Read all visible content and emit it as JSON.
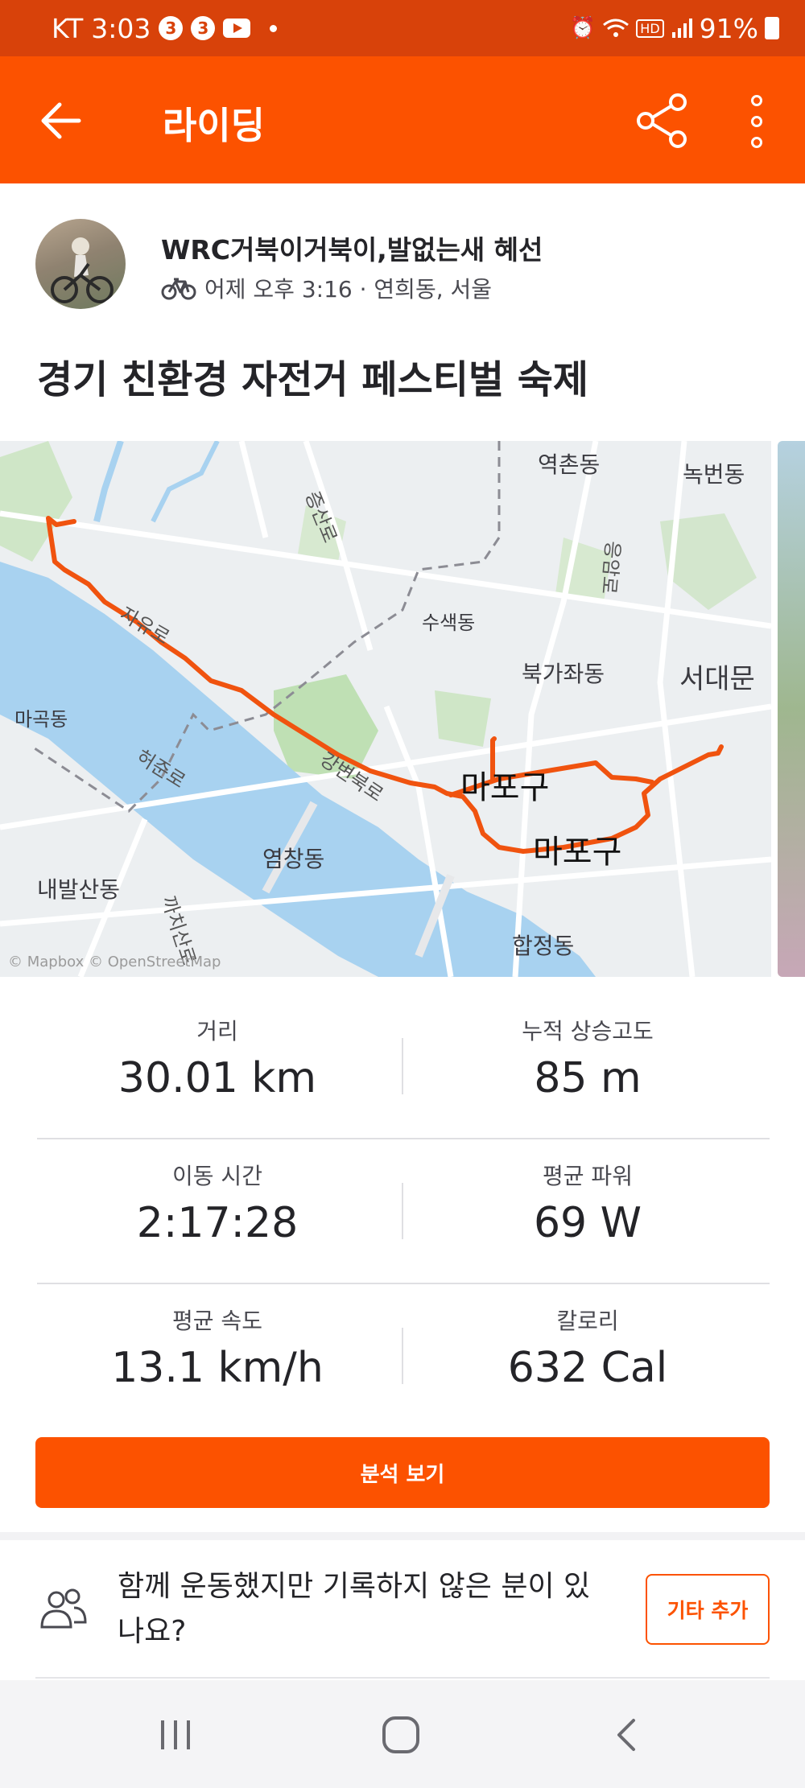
{
  "status_bar": {
    "carrier": "KT",
    "time": "3:03",
    "badge1": "3",
    "badge2": "3",
    "battery": "91%",
    "hd_label": "HD"
  },
  "app_bar": {
    "title": "라이딩"
  },
  "athlete": {
    "name": "WRC거북이거북이,발없는새 혜선",
    "meta": "어제 오후 3:16 · 연희동, 서울"
  },
  "activity": {
    "title": "경기 친환경 자전거 페스티벌 숙제"
  },
  "map": {
    "labels": {
      "yeokchon": "역촌동",
      "nokbeon": "녹번동",
      "susaek": "수색동",
      "bukgajwa": "북가좌동",
      "seodaemun": "서대문",
      "magok": "마곡동",
      "mapo1": "마포구",
      "mapo2": "마포구",
      "yeomchang": "염창동",
      "naebalsan": "내발산동",
      "hapjeong": "합정동",
      "gangbyeon": "강변북로",
      "heojun": "허준로",
      "jayu": "자유로",
      "jeungsan": "증산로",
      "kkachisan": "까치산로",
      "eungam": "응암로"
    },
    "attribution": "© Mapbox © OpenStreetMap"
  },
  "stats": [
    {
      "label": "거리",
      "value": "30.01 km"
    },
    {
      "label": "누적 상승고도",
      "value": "85 m"
    },
    {
      "label": "이동 시간",
      "value": "2:17:28"
    },
    {
      "label": "평균 파워",
      "value": "69 W"
    },
    {
      "label": "평균 속도",
      "value": "13.1 km/h"
    },
    {
      "label": "칼로리",
      "value": "632 Cal"
    }
  ],
  "actions": {
    "analyze": "분석 보기",
    "together_prompt": "함께 운동했지만 기록하지 않은 분이 있나요?",
    "add_other": "기타 추가"
  },
  "colors": {
    "brand": "#fc5200",
    "status_bar": "#d8420a",
    "route": "#f0530f",
    "water": "#a8d2f0"
  }
}
